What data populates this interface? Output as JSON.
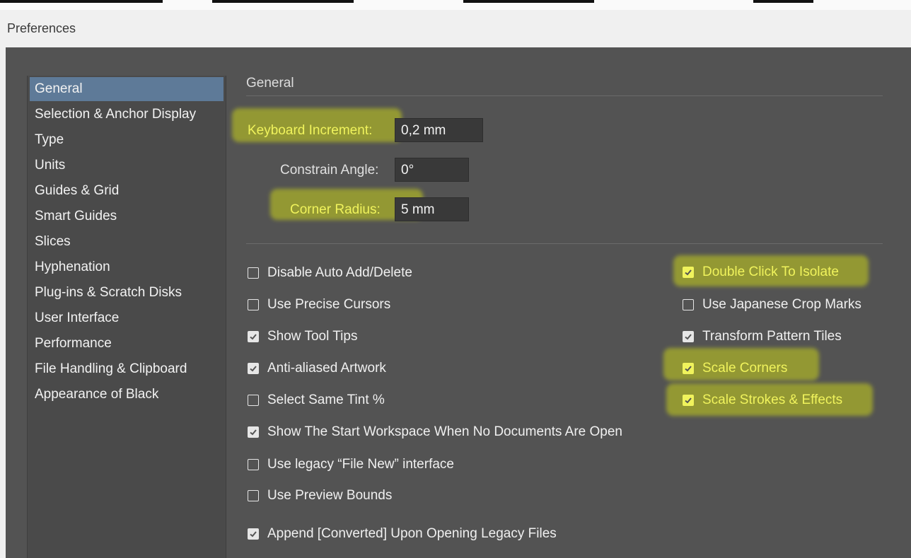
{
  "window": {
    "title": "Preferences"
  },
  "sidebar": {
    "items": [
      {
        "label": "General",
        "active": true
      },
      {
        "label": "Selection & Anchor Display"
      },
      {
        "label": "Type"
      },
      {
        "label": "Units"
      },
      {
        "label": "Guides & Grid"
      },
      {
        "label": "Smart Guides"
      },
      {
        "label": "Slices"
      },
      {
        "label": "Hyphenation"
      },
      {
        "label": "Plug-ins & Scratch Disks"
      },
      {
        "label": "User Interface"
      },
      {
        "label": "Performance"
      },
      {
        "label": "File Handling & Clipboard"
      },
      {
        "label": "Appearance of Black"
      }
    ]
  },
  "general": {
    "section_title": "General",
    "keyboard_increment": {
      "label": "Keyboard Increment:",
      "value": "0,2 mm"
    },
    "constrain_angle": {
      "label": "Constrain Angle:",
      "value": "0°"
    },
    "corner_radius": {
      "label": "Corner Radius:",
      "value": "5 mm"
    }
  },
  "options_left": [
    {
      "label": "Disable Auto Add/Delete",
      "checked": false
    },
    {
      "label": "Use Precise Cursors",
      "checked": false
    },
    {
      "label": "Show Tool Tips",
      "checked": true
    },
    {
      "label": "Anti-aliased Artwork",
      "checked": true
    },
    {
      "label": "Select Same Tint %",
      "checked": false
    },
    {
      "label": "Show The Start Workspace When No Documents Are Open",
      "checked": true
    },
    {
      "label": "Use legacy “File New” interface",
      "checked": false
    },
    {
      "label": "Use Preview Bounds",
      "checked": false
    },
    {
      "label": "Append [Converted] Upon Opening Legacy Files",
      "checked": true
    }
  ],
  "options_right": [
    {
      "label": "Double Click To Isolate",
      "checked": true,
      "highlighted": true
    },
    {
      "label": "Use Japanese Crop Marks",
      "checked": false
    },
    {
      "label": "Transform Pattern Tiles",
      "checked": true
    },
    {
      "label": "Scale Corners",
      "checked": true,
      "highlighted": true
    },
    {
      "label": "Scale Strokes & Effects",
      "checked": true,
      "highlighted": true
    }
  ],
  "colors": {
    "dialog_bg": "#535353",
    "sidebar_bg": "#4a4a4a",
    "active_item": "#5e7a98",
    "highlight": "#c9d21a",
    "highlight_text": "#f0f35c"
  }
}
